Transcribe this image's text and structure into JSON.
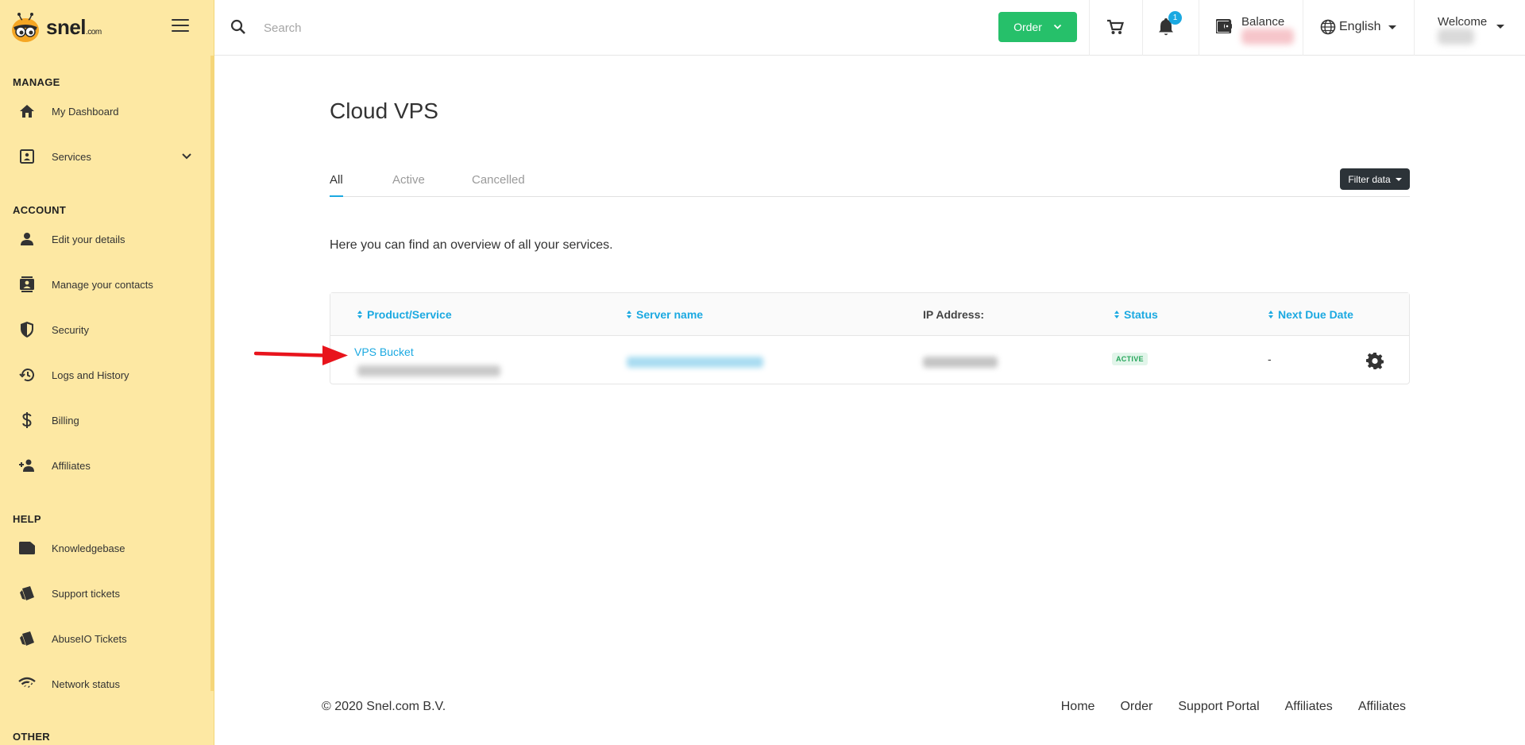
{
  "logo": {
    "text": "snel",
    "suffix": ".com"
  },
  "sidebar": {
    "sections": {
      "manage": "MANAGE",
      "account": "ACCOUNT",
      "help": "HELP",
      "other": "OTHER"
    },
    "items": [
      {
        "label": "My Dashboard",
        "icon": "home-icon"
      },
      {
        "label": "Services",
        "icon": "services-icon"
      },
      {
        "label": "Edit your details",
        "icon": "person-icon"
      },
      {
        "label": "Manage your contacts",
        "icon": "contacts-icon"
      },
      {
        "label": "Security",
        "icon": "shield-icon"
      },
      {
        "label": "Logs and History",
        "icon": "history-icon"
      },
      {
        "label": "Billing",
        "icon": "dollar-icon"
      },
      {
        "label": "Affiliates",
        "icon": "affiliates-icon"
      },
      {
        "label": "Knowledgebase",
        "icon": "folder-icon"
      },
      {
        "label": "Support tickets",
        "icon": "ticket-icon"
      },
      {
        "label": "AbuseIO Tickets",
        "icon": "ticket-icon"
      },
      {
        "label": "Network status",
        "icon": "wifi-icon"
      }
    ]
  },
  "header": {
    "search_placeholder": "Search",
    "order_label": "Order",
    "notification_count": "1",
    "balance_label": "Balance",
    "language": "English",
    "welcome": "Welcome"
  },
  "main": {
    "title": "Cloud VPS",
    "tabs": [
      {
        "label": "All",
        "active": true
      },
      {
        "label": "Active",
        "active": false
      },
      {
        "label": "Cancelled",
        "active": false
      }
    ],
    "filter_label": "Filter data",
    "intro": "Here you can find an overview of all your services.",
    "table": {
      "columns": [
        "Product/Service",
        "Server name",
        "IP Address:",
        "Status",
        "Next Due Date"
      ],
      "rows": [
        {
          "product": "VPS Bucket",
          "status": "ACTIVE",
          "due": "-"
        }
      ]
    }
  },
  "footer": {
    "copyright": "© 2020 Snel.com B.V.",
    "links": [
      "Home",
      "Order",
      "Support Portal",
      "Affiliates",
      "Affiliates"
    ]
  },
  "colors": {
    "sidebar_bg": "#fde8a3",
    "accent": "#1ba9e1",
    "order_green": "#26c06a",
    "annotation_arrow": "#e8141c"
  }
}
